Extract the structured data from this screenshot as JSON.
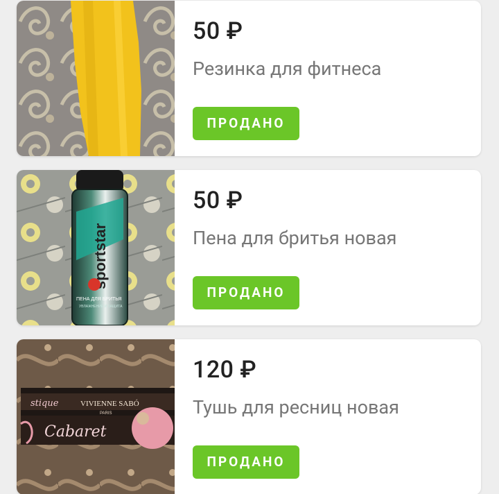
{
  "items": [
    {
      "price": "50 ₽",
      "title": "Резинка для фитнеса",
      "status_label": "ПРОДАНО",
      "image_alt": "yellow fitness band on patterned fabric"
    },
    {
      "price": "50 ₽",
      "title": "Пена для бритья новая",
      "status_label": "ПРОДАНО",
      "image_alt": "sportstar shaving foam can",
      "image_text": {
        "brand": "sportstar",
        "subtitle": "ПЕНА ДЛЯ БРИТЬЯ",
        "line": "УВЛАЖНЕНИЕ И ЗАЩИТА"
      }
    },
    {
      "price": "120 ₽",
      "title": "Тушь для ресниц новая",
      "status_label": "ПРОДАНО",
      "image_alt": "Vivienne Sabo Cabaret mascara box",
      "image_text": {
        "brand": "VIVIENNE SABÓ",
        "city": "PARIS",
        "product": "Cabaret",
        "line": "stique"
      }
    }
  ],
  "colors": {
    "sold_badge": "#6bc628",
    "price_text": "#222222",
    "title_text": "#767676",
    "card_bg": "#ffffff",
    "page_bg": "#eeeeee"
  }
}
